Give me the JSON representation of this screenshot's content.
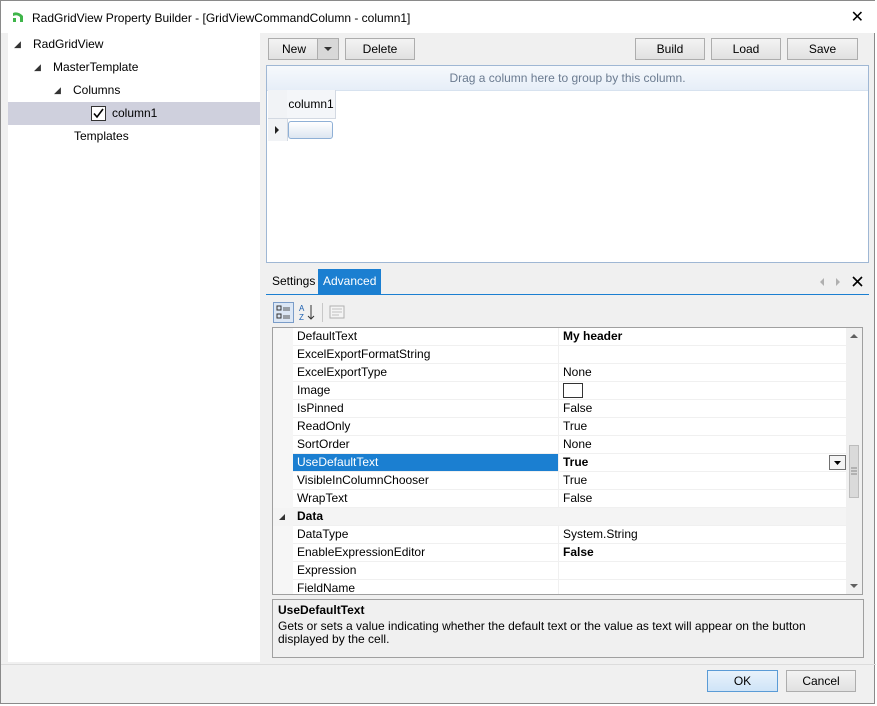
{
  "window": {
    "title": "RadGridView Property Builder - [GridViewCommandColumn - column1]",
    "close_glyph": "✕"
  },
  "tree": {
    "nodes": [
      {
        "label": "RadGridView",
        "expander": "◢"
      },
      {
        "label": "MasterTemplate",
        "expander": "◢"
      },
      {
        "label": "Columns",
        "expander": "◢"
      },
      {
        "label": "column1",
        "checked": true
      },
      {
        "label": "Templates"
      }
    ]
  },
  "toolbar": {
    "new_label": "New",
    "delete_label": "Delete",
    "build_label": "Build",
    "load_label": "Load",
    "save_label": "Save"
  },
  "grid": {
    "group_panel_text": "Drag a column here to group by this column.",
    "column_header": "column1"
  },
  "tabs": {
    "items": [
      "Settings",
      "Advanced"
    ],
    "active": "Advanced"
  },
  "property_grid": {
    "rows": [
      {
        "name": "DefaultText",
        "value": "My header",
        "bold": true
      },
      {
        "name": "ExcelExportFormatString",
        "value": ""
      },
      {
        "name": "ExcelExportType",
        "value": "None"
      },
      {
        "name": "Image",
        "value": ""
      },
      {
        "name": "IsPinned",
        "value": "False"
      },
      {
        "name": "ReadOnly",
        "value": "True"
      },
      {
        "name": "SortOrder",
        "value": "None"
      },
      {
        "name": "UseDefaultText",
        "value": "True",
        "bold": true,
        "selected": true
      },
      {
        "name": "VisibleInColumnChooser",
        "value": "True"
      },
      {
        "name": "WrapText",
        "value": "False"
      },
      {
        "name": "Data",
        "value": "",
        "category": true
      },
      {
        "name": "DataType",
        "value": "System.String"
      },
      {
        "name": "EnableExpressionEditor",
        "value": "False",
        "bold": true
      },
      {
        "name": "Expression",
        "value": ""
      },
      {
        "name": "FieldName",
        "value": ""
      }
    ]
  },
  "description": {
    "title": "UseDefaultText",
    "text": "Gets or sets a value indicating whether the default text or the value as text will appear on the button displayed by the cell."
  },
  "footer": {
    "ok_label": "OK",
    "cancel_label": "Cancel"
  },
  "colors": {
    "accent": "#1b7fd1",
    "tree_selection": "#cfd0dd",
    "logo_green": "#3fb54a"
  }
}
